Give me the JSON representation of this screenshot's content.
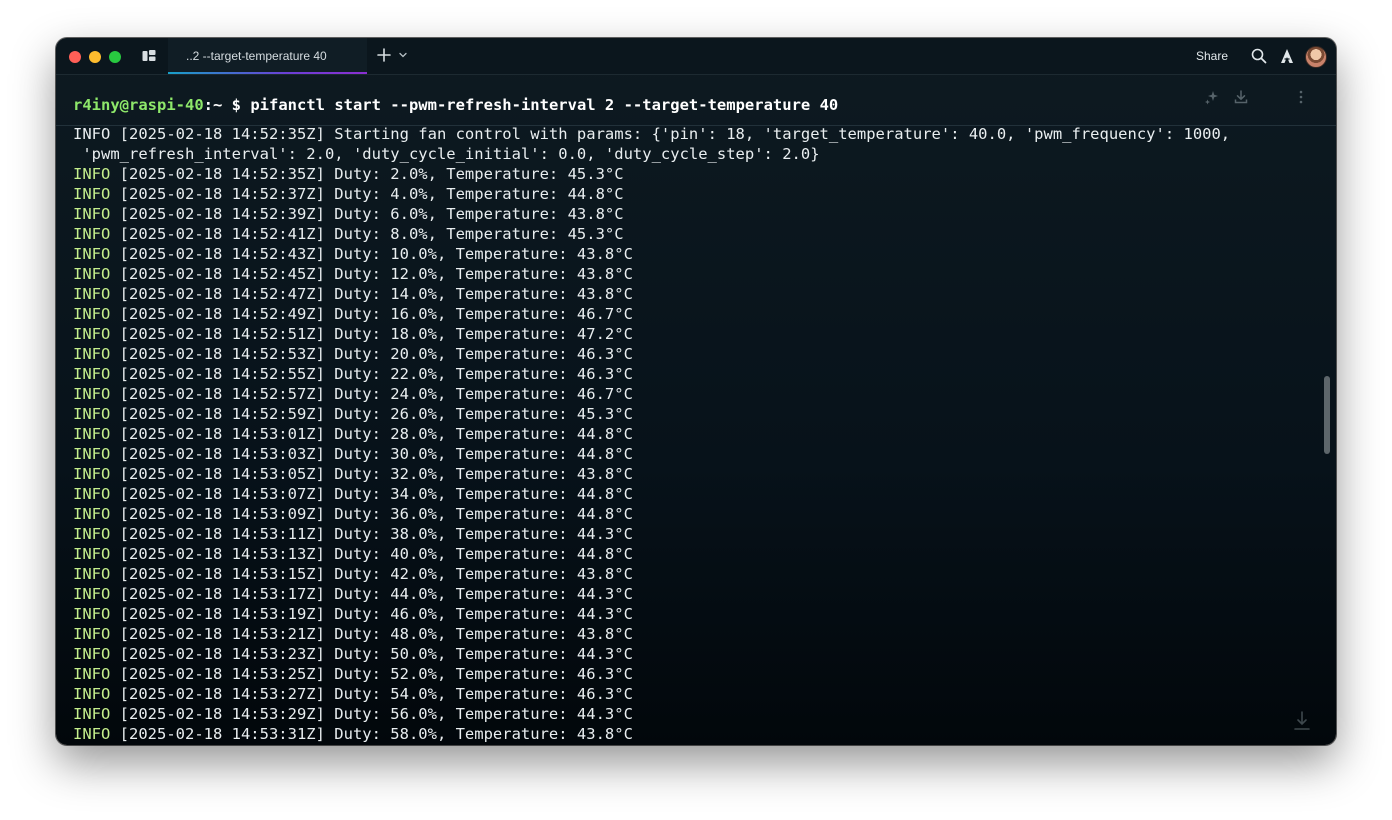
{
  "titlebar": {
    "tab_label": "..2 --target-temperature 40",
    "share_label": "Share"
  },
  "colors": {
    "prompt_host": "#8ee86a",
    "info_level": "#c6f08d",
    "tab_accent": "#6c3fd6",
    "background": "#07121a"
  },
  "icons": {
    "panes": "panes-icon",
    "new_tab": "plus-icon",
    "tab_menu": "chevron-down-icon",
    "search": "search-icon",
    "warp": "warp-logo-icon",
    "sparkle": "sparkle-icon",
    "save": "download-icon",
    "more": "more-vertical-icon",
    "scroll_bottom": "scroll-to-bottom-icon"
  },
  "prompt": {
    "host": "r4iny@raspi-40",
    "path": ":~",
    "symbol": " $ ",
    "command": "pifanctl start --pwm-refresh-interval 2 --target-temperature 40"
  },
  "output": {
    "lines": [
      {
        "level": "INFO",
        "text": " [2025-02-18 14:52:35Z] Starting fan control with params: {'pin': 18, 'target_temperature': 40.0, 'pwm_frequency': 1000,",
        "level_color": "white"
      },
      {
        "level": "",
        "text": " 'pwm_refresh_interval': 2.0, 'duty_cycle_initial': 0.0, 'duty_cycle_step': 2.0}",
        "level_color": "white"
      },
      {
        "level": "INFO",
        "text": " [2025-02-18 14:52:35Z] Duty: 2.0%, Temperature: 45.3°C",
        "level_color": "green"
      },
      {
        "level": "INFO",
        "text": " [2025-02-18 14:52:37Z] Duty: 4.0%, Temperature: 44.8°C",
        "level_color": "green"
      },
      {
        "level": "INFO",
        "text": " [2025-02-18 14:52:39Z] Duty: 6.0%, Temperature: 43.8°C",
        "level_color": "green"
      },
      {
        "level": "INFO",
        "text": " [2025-02-18 14:52:41Z] Duty: 8.0%, Temperature: 45.3°C",
        "level_color": "green"
      },
      {
        "level": "INFO",
        "text": " [2025-02-18 14:52:43Z] Duty: 10.0%, Temperature: 43.8°C",
        "level_color": "green"
      },
      {
        "level": "INFO",
        "text": " [2025-02-18 14:52:45Z] Duty: 12.0%, Temperature: 43.8°C",
        "level_color": "green"
      },
      {
        "level": "INFO",
        "text": " [2025-02-18 14:52:47Z] Duty: 14.0%, Temperature: 43.8°C",
        "level_color": "green"
      },
      {
        "level": "INFO",
        "text": " [2025-02-18 14:52:49Z] Duty: 16.0%, Temperature: 46.7°C",
        "level_color": "green"
      },
      {
        "level": "INFO",
        "text": " [2025-02-18 14:52:51Z] Duty: 18.0%, Temperature: 47.2°C",
        "level_color": "green"
      },
      {
        "level": "INFO",
        "text": " [2025-02-18 14:52:53Z] Duty: 20.0%, Temperature: 46.3°C",
        "level_color": "green"
      },
      {
        "level": "INFO",
        "text": " [2025-02-18 14:52:55Z] Duty: 22.0%, Temperature: 46.3°C",
        "level_color": "green"
      },
      {
        "level": "INFO",
        "text": " [2025-02-18 14:52:57Z] Duty: 24.0%, Temperature: 46.7°C",
        "level_color": "green"
      },
      {
        "level": "INFO",
        "text": " [2025-02-18 14:52:59Z] Duty: 26.0%, Temperature: 45.3°C",
        "level_color": "green"
      },
      {
        "level": "INFO",
        "text": " [2025-02-18 14:53:01Z] Duty: 28.0%, Temperature: 44.8°C",
        "level_color": "green"
      },
      {
        "level": "INFO",
        "text": " [2025-02-18 14:53:03Z] Duty: 30.0%, Temperature: 44.8°C",
        "level_color": "green"
      },
      {
        "level": "INFO",
        "text": " [2025-02-18 14:53:05Z] Duty: 32.0%, Temperature: 43.8°C",
        "level_color": "green"
      },
      {
        "level": "INFO",
        "text": " [2025-02-18 14:53:07Z] Duty: 34.0%, Temperature: 44.8°C",
        "level_color": "green"
      },
      {
        "level": "INFO",
        "text": " [2025-02-18 14:53:09Z] Duty: 36.0%, Temperature: 44.8°C",
        "level_color": "green"
      },
      {
        "level": "INFO",
        "text": " [2025-02-18 14:53:11Z] Duty: 38.0%, Temperature: 44.3°C",
        "level_color": "green"
      },
      {
        "level": "INFO",
        "text": " [2025-02-18 14:53:13Z] Duty: 40.0%, Temperature: 44.8°C",
        "level_color": "green"
      },
      {
        "level": "INFO",
        "text": " [2025-02-18 14:53:15Z] Duty: 42.0%, Temperature: 43.8°C",
        "level_color": "green"
      },
      {
        "level": "INFO",
        "text": " [2025-02-18 14:53:17Z] Duty: 44.0%, Temperature: 44.3°C",
        "level_color": "green"
      },
      {
        "level": "INFO",
        "text": " [2025-02-18 14:53:19Z] Duty: 46.0%, Temperature: 44.3°C",
        "level_color": "green"
      },
      {
        "level": "INFO",
        "text": " [2025-02-18 14:53:21Z] Duty: 48.0%, Temperature: 43.8°C",
        "level_color": "green"
      },
      {
        "level": "INFO",
        "text": " [2025-02-18 14:53:23Z] Duty: 50.0%, Temperature: 44.3°C",
        "level_color": "green"
      },
      {
        "level": "INFO",
        "text": " [2025-02-18 14:53:25Z] Duty: 52.0%, Temperature: 46.3°C",
        "level_color": "green"
      },
      {
        "level": "INFO",
        "text": " [2025-02-18 14:53:27Z] Duty: 54.0%, Temperature: 46.3°C",
        "level_color": "green"
      },
      {
        "level": "INFO",
        "text": " [2025-02-18 14:53:29Z] Duty: 56.0%, Temperature: 44.3°C",
        "level_color": "green"
      },
      {
        "level": "INFO",
        "text": " [2025-02-18 14:53:31Z] Duty: 58.0%, Temperature: 43.8°C",
        "level_color": "green"
      }
    ]
  }
}
